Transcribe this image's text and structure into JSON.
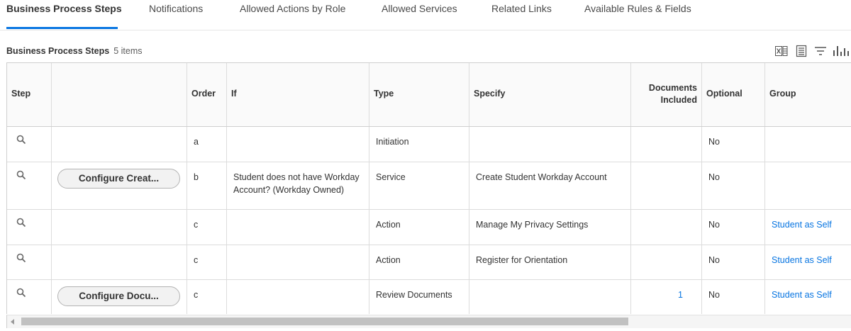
{
  "tabs": [
    {
      "label": "Business Process Steps",
      "active": true
    },
    {
      "label": "Notifications"
    },
    {
      "label": "Allowed Actions by Role"
    },
    {
      "label": "Allowed Services"
    },
    {
      "label": "Related Links"
    },
    {
      "label": "Available Rules & Fields"
    }
  ],
  "section": {
    "title": "Business Process Steps",
    "count": "5 items"
  },
  "toolbar_icons": [
    "export-excel-icon",
    "view-toggle-icon",
    "filter-icon",
    "column-chart-icon"
  ],
  "table": {
    "headers": {
      "step": "Step",
      "action": "",
      "order": "Order",
      "if": "If",
      "type": "Type",
      "specify": "Specify",
      "documents_line1": "Documents",
      "documents_line2": "Included",
      "optional": "Optional",
      "group": "Group"
    },
    "rows": [
      {
        "button": "",
        "order": "a",
        "if": "",
        "type": "Initiation",
        "specify": "",
        "documents": "",
        "optional": "No",
        "group": ""
      },
      {
        "button": "Configure Creat...",
        "order": "b",
        "if": "Student does not have Workday Account? (Workday Owned)",
        "type": "Service",
        "specify": "Create Student Workday Account",
        "documents": "",
        "optional": "No",
        "group": ""
      },
      {
        "button": "",
        "order": "c",
        "if": "",
        "type": "Action",
        "specify": "Manage My Privacy Settings",
        "documents": "",
        "optional": "No",
        "group": "Student as Self"
      },
      {
        "button": "",
        "order": "c",
        "if": "",
        "type": "Action",
        "specify": "Register for Orientation",
        "documents": "",
        "optional": "No",
        "group": "Student as Self"
      },
      {
        "button": "Configure Docu...",
        "order": "c",
        "if": "",
        "type": "Review Documents",
        "specify": "",
        "documents": "1",
        "optional": "No",
        "group": "Student as Self"
      }
    ]
  },
  "colors": {
    "accent": "#0875e1",
    "link": "#0875e1",
    "border": "#cfcfcf"
  }
}
